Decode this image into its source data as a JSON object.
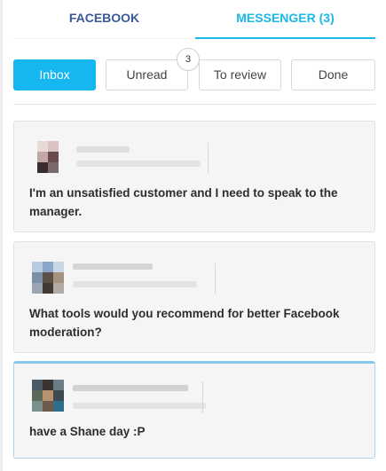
{
  "tabs": {
    "facebook_label": "FACEBOOK",
    "messenger_label": "MESSENGER (3)",
    "active": "messenger"
  },
  "filters": [
    {
      "label": "Inbox",
      "active": true
    },
    {
      "label": "Unread",
      "badge": "3"
    },
    {
      "label": "To review"
    },
    {
      "label": "Done"
    }
  ],
  "conversations": [
    {
      "message": "I'm an unsatisfied customer and I need to speak to the manager.",
      "avatar_note": "blurred-avatar"
    },
    {
      "message": "What tools would you recommend for better Facebook moderation?",
      "avatar_note": "blurred-avatar"
    },
    {
      "message": "have a Shane day :P",
      "avatar_note": "blurred-avatar",
      "selected": true
    }
  ],
  "colors": {
    "facebook_blue": "#3b5998",
    "messenger_cyan": "#1cb8e6",
    "active_button": "#16b7f0",
    "card_bg": "#f5f5f5"
  }
}
